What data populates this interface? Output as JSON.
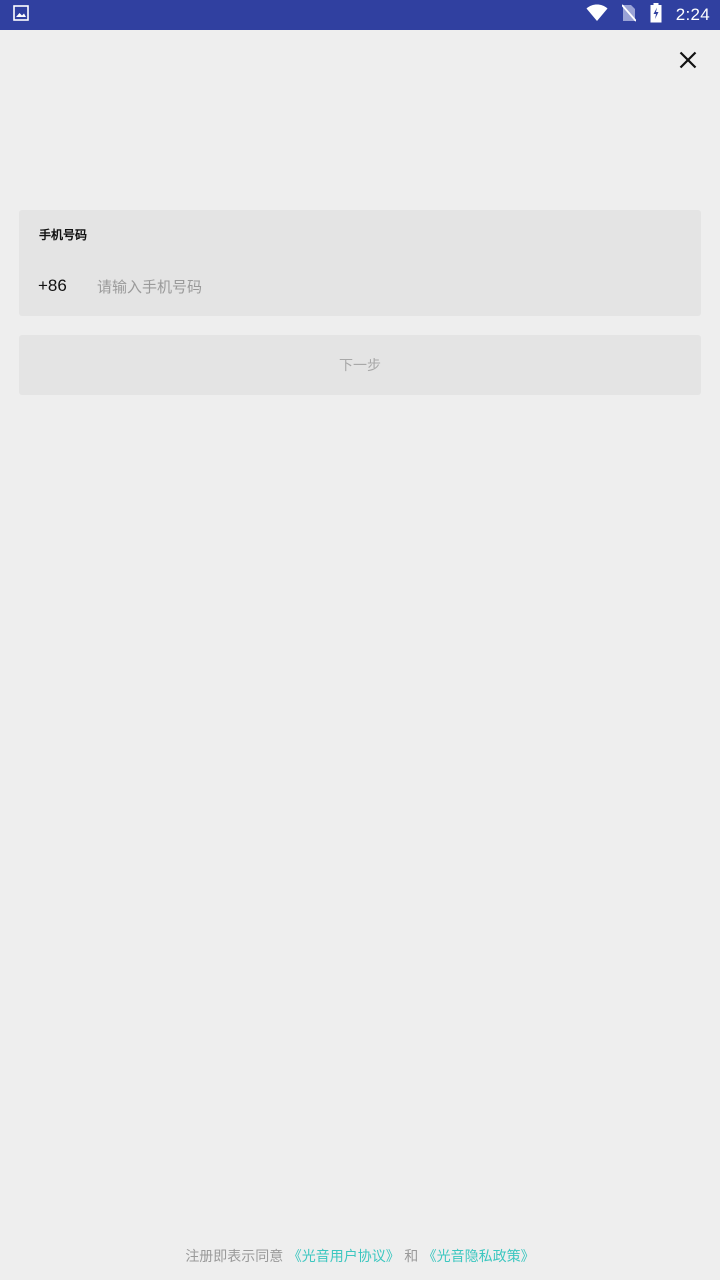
{
  "status_bar": {
    "time": "2:24",
    "icons": [
      "image-icon",
      "wifi-icon",
      "no-sim-icon",
      "battery-charging-icon"
    ],
    "background": "#3040a0"
  },
  "close": {
    "icon": "close-icon"
  },
  "phone_form": {
    "label": "手机号码",
    "country_code": "+86",
    "placeholder": "请输入手机号码",
    "value": ""
  },
  "next_button": {
    "label": "下一步"
  },
  "agreement": {
    "prefix": "注册即表示同意",
    "user_agreement": "《光音用户协议》",
    "conjunction": "和",
    "privacy_policy": "《光音隐私政策》",
    "link_color": "#3cc7c0"
  }
}
